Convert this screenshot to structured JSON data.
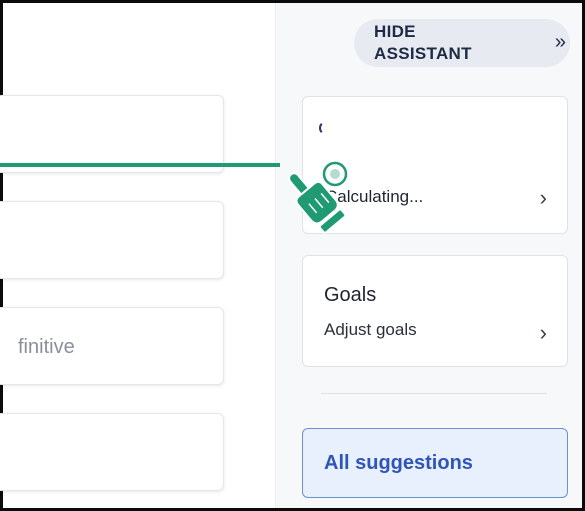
{
  "editor": {
    "cards": [
      {
        "text": ""
      },
      {
        "text": ""
      },
      {
        "text": "finitive"
      },
      {
        "text": ""
      }
    ]
  },
  "assistant": {
    "hide_button": {
      "label": "HIDE ASSISTANT",
      "icon": "double-chevron-right-icon"
    },
    "score_card": {
      "status": "Calculating...",
      "icon": "spinner-icon"
    },
    "goals_card": {
      "title": "Goals",
      "subtitle": "Adjust goals"
    },
    "all_suggestions": {
      "label": "All suggestions"
    }
  },
  "overlay": {
    "pointer_icon": "pointing-hand-icon"
  },
  "colors": {
    "accent_green": "#1f9a72",
    "link_blue": "#2f55b8",
    "all_suggestions_bg": "#e9f0fd",
    "panel_bg": "#f7f8fa"
  }
}
